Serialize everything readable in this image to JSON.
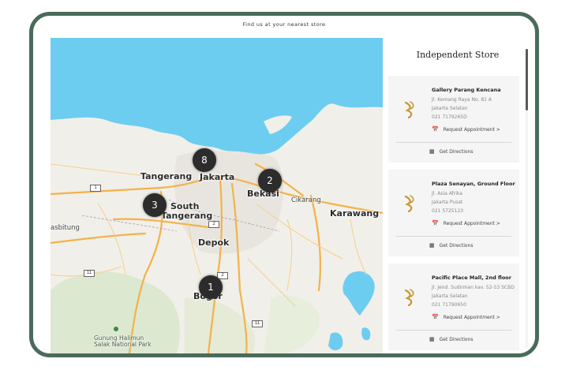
{
  "page": {
    "title": "Find us at your nearest store"
  },
  "map": {
    "cities": [
      {
        "name": "Jakarta",
        "size": "big"
      },
      {
        "name": "Tangerang",
        "size": "big"
      },
      {
        "name": "Bekasi",
        "size": "big"
      },
      {
        "name": "South",
        "size": "big"
      },
      {
        "name": "Tangerang",
        "size": "big"
      },
      {
        "name": "Depok",
        "size": "big"
      },
      {
        "name": "Karawang",
        "size": "big"
      },
      {
        "name": "Bogor",
        "size": "big"
      },
      {
        "name": "Cikarang",
        "size": "small"
      },
      {
        "name": "asbitung",
        "size": "small"
      }
    ],
    "park": {
      "line1": "Gunung Halimun",
      "line2": "Salak National Park"
    },
    "markers": [
      "8",
      "2",
      "3",
      "1"
    ],
    "road_shields": [
      "1",
      "2",
      "2",
      "11",
      "11"
    ],
    "colors": {
      "water": "#6ccdf0",
      "land": "#f1efe9",
      "road": "#f3b24a",
      "marker": "#2c2c2c",
      "frame": "#4a6b5c"
    }
  },
  "sidebar": {
    "title": "Independent Store",
    "stores": [
      {
        "name": "Gallery Parang Kencana",
        "address1": "Jl. Kemang Raya No. 81 A",
        "address2": "Jakarta Selatan",
        "phone": "021 7179265D",
        "appointment": "Request Appointment >",
        "directions": "Get Directions"
      },
      {
        "name": "Plaza Senayan, Ground Floor",
        "address1": "Jl. Asia Afrika",
        "address2": "Jakarta Pusat",
        "phone": "021 5725123",
        "appointment": "Request Appointment >",
        "directions": "Get Directions"
      },
      {
        "name": "Pacific Place Mall, 2nd floor",
        "address1": "Jl. Jend. Sudirman kav. 52-53 SCBD",
        "address2": "Jakarta Selatan",
        "phone": "021 71790650",
        "appointment": "Request Appointment >",
        "directions": "Get Directions"
      }
    ]
  }
}
